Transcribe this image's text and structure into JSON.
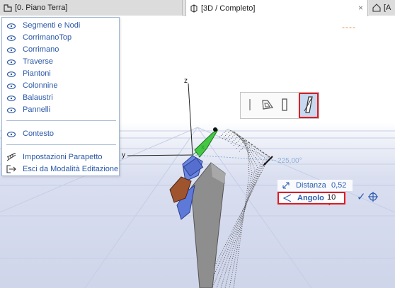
{
  "tabs": [
    {
      "label": "[0. Piano Terra]",
      "icon": "floor-plan-icon"
    },
    {
      "label": "[3D / Completo]",
      "icon": "3d-box-icon"
    },
    {
      "label": "[A",
      "icon": "home-icon"
    }
  ],
  "menu": {
    "visibility_items": [
      {
        "label": "Segmenti e Nodi"
      },
      {
        "label": "CorrimanoTop"
      },
      {
        "label": "Corrimano"
      },
      {
        "label": "Traverse"
      },
      {
        "label": "Piantoni"
      },
      {
        "label": "Colonnine"
      },
      {
        "label": "Balaustri"
      },
      {
        "label": "Pannelli"
      }
    ],
    "context_label": "Contesto",
    "settings_label": "Impostazioni Parapetto",
    "exit_label": "Esci da Modalità Editazione"
  },
  "viewport": {
    "dashes": "----",
    "axis_z": "z",
    "axis_y": "y",
    "axis_x": "x",
    "angle_readout": "225,00°"
  },
  "tracker": {
    "distance_label": "Distanza",
    "distance_value": "0,52",
    "angle_label": "Angolo",
    "angle_value": "10"
  },
  "colors": {
    "menu_text": "#2a58a8",
    "highlight": "#e11b22",
    "dashes": "#e58c46"
  }
}
